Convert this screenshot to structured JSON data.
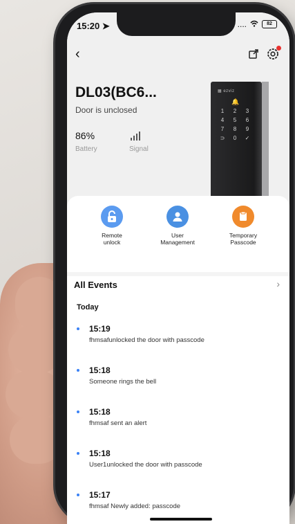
{
  "status_bar": {
    "time": "15:20",
    "signal": "....",
    "battery": "82"
  },
  "device": {
    "name": "DL03(BC6...",
    "status": "Door is unclosed"
  },
  "stats": {
    "battery_value": "86%",
    "battery_label": "Battery",
    "signal_label": "Signal"
  },
  "lock_image": {
    "brand": "ezviz",
    "keys": [
      "1",
      "2",
      "3",
      "4",
      "5",
      "6",
      "7",
      "8",
      "9",
      "⊃",
      "0",
      "✓"
    ]
  },
  "actions": [
    {
      "label": "Remote\nunlock",
      "color": "#5b9bf0",
      "icon": "lock-open-icon"
    },
    {
      "label": "User\nManagement",
      "color": "#4a90e2",
      "icon": "user-icon"
    },
    {
      "label": "Temporary\nPasscode",
      "color": "#f08a2c",
      "icon": "passcode-icon"
    }
  ],
  "events": {
    "title": "All Events",
    "group": "Today",
    "items": [
      {
        "time": "15:19",
        "desc": "fhmsafunlocked the door with passcode"
      },
      {
        "time": "15:18",
        "desc": "Someone rings the bell"
      },
      {
        "time": "15:18",
        "desc": "fhmsaf sent an alert"
      },
      {
        "time": "15:18",
        "desc": "User1unlocked the door with passcode"
      },
      {
        "time": "15:17",
        "desc": "fhmsaf Newly added: passcode"
      }
    ]
  },
  "colors": {
    "accent_blue": "#3b82f6",
    "alert_red": "#e8312f"
  }
}
